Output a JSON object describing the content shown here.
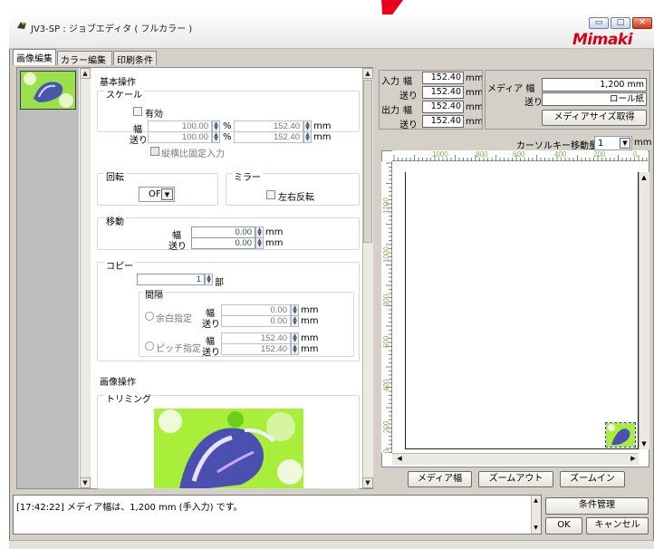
{
  "window": {
    "title": "JV3-SP : ジョブエディタ ( フルカラー )"
  },
  "brand": {
    "logo": "Mimaki",
    "accent": "#d4001a"
  },
  "tabs": [
    {
      "label": "画像編集"
    },
    {
      "label": "カラー編集"
    },
    {
      "label": "印刷条件"
    }
  ],
  "left": {
    "basic_ops": "基本操作",
    "scale": {
      "title": "スケール",
      "enable_label": "有効",
      "width_label": "幅",
      "feed_label": "送り",
      "width_pct": "100.00",
      "feed_pct": "100.00",
      "width_mm": "152.40",
      "feed_mm": "152.40",
      "pct_unit": "%",
      "mm_unit": "mm",
      "aspect_lock": "縦横比固定入力"
    },
    "rotate": {
      "title": "回転",
      "value": "OFF"
    },
    "mirror": {
      "title": "ミラー",
      "lr_label": "左右反転"
    },
    "move": {
      "title": "移動",
      "width_label": "幅",
      "feed_label": "送り",
      "width": "0.00",
      "feed": "0.00",
      "unit": "mm"
    },
    "copy": {
      "title": "コピー",
      "count": "1",
      "count_unit": "部",
      "interval": "間隔",
      "blank_spec": "余白指定",
      "pitch_spec": "ピッチ指定",
      "width_label": "幅",
      "feed_label": "送り",
      "blank_w": "0.00",
      "blank_f": "0.00",
      "pitch_w": "152.40",
      "pitch_f": "152.40",
      "unit": "mm"
    },
    "image_ops": "画像操作",
    "trimming": "トリミング"
  },
  "right": {
    "input_label": "入力",
    "output_label": "出力",
    "width_label": "幅",
    "feed_label": "送り",
    "in_w": "152.40",
    "in_f": "152.40",
    "out_w": "152.40",
    "out_f": "152.40",
    "unit": "mm",
    "media_label": "メディア 幅",
    "media_feed_label": "送り",
    "media_width": "1,200 mm",
    "media_feed": "ロール紙",
    "get_media_size": "メディアサイズ取得",
    "cursor_move_label": "カーソルキー移動量",
    "cursor_move_value": "1",
    "cursor_move_unit": "mm",
    "ruler_h": [
      "1000",
      "800",
      "600",
      "400",
      "200",
      "0"
    ],
    "ruler_v": [
      "1200",
      "1000",
      "800",
      "600",
      "400",
      "200",
      "0"
    ],
    "btn_media_width": "メディア幅",
    "btn_zoom_out": "ズームアウト",
    "btn_zoom_in": "ズームイン"
  },
  "status": {
    "message": "[17:42:22] メディア幅は、1,200 mm (手入力) です。"
  },
  "footer": {
    "condition_mgmt": "条件管理",
    "ok": "OK",
    "cancel": "キャンセル"
  }
}
